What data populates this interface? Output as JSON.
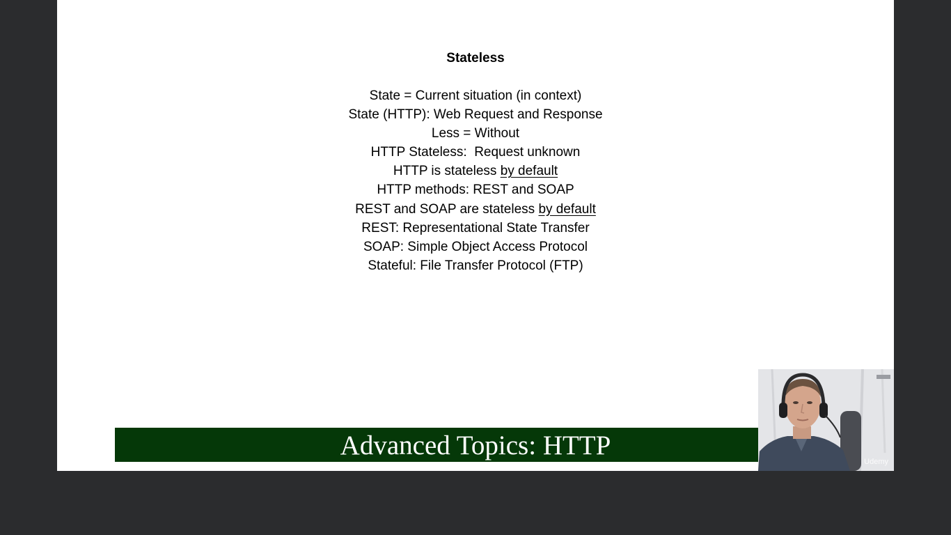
{
  "slide": {
    "title": "Stateless",
    "lines": [
      {
        "text": "State = Current situation (in context)",
        "underlined": ""
      },
      {
        "text": "State (HTTP): Web Request and Response",
        "underlined": ""
      },
      {
        "text": "Less = Without",
        "underlined": ""
      },
      {
        "text": "HTTP Stateless:  Request unknown",
        "underlined": ""
      },
      {
        "text": "HTTP is stateless ",
        "underlined": "by default"
      },
      {
        "text": "HTTP methods: REST and SOAP",
        "underlined": ""
      },
      {
        "text": "REST and SOAP are stateless ",
        "underlined": "by default"
      },
      {
        "text": "REST: Representational State Transfer",
        "underlined": ""
      },
      {
        "text": "SOAP: Simple Object Access Protocol",
        "underlined": ""
      },
      {
        "text": "Stateful: File Transfer Protocol (FTP)",
        "underlined": ""
      }
    ]
  },
  "banner": {
    "text": "Advanced Topics: HTTP",
    "color": "#053808"
  },
  "webcam": {
    "watermark": "Udemy"
  },
  "colors": {
    "background": "#2b2c2e",
    "slide": "#ffffff",
    "text": "#000000"
  }
}
